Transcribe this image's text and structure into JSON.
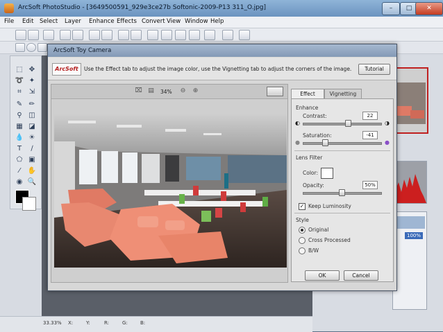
{
  "app": {
    "title": "ArcSoft PhotoStudio - [3649500591_929e3ce27b Softonic-2009-P13 311_O.jpg]",
    "window_buttons": {
      "minimize": "–",
      "maximize": "□",
      "close": "✕"
    },
    "menu": [
      "File",
      "Edit",
      "Select",
      "Layer",
      "Enhance",
      "Effects",
      "Convert",
      "View",
      "Window",
      "Help"
    ]
  },
  "status": {
    "zoom": "33.33%",
    "r": "R:",
    "g": "G:",
    "b": "B:",
    "y": "Y:",
    "x": "X:"
  },
  "layers": {
    "opacity": "100%"
  },
  "dialog": {
    "title": "ArcSoft Toy Camera",
    "logo": "ArcSoft",
    "instructions": "Use the Effect tab to adjust the image color, use the Vignetting tab to adjust the corners of the image.",
    "tutorial_label": "Tutorial",
    "zoom": "34%",
    "tabs": {
      "effect": "Effect",
      "vignetting": "Vignetting"
    },
    "enhance": {
      "label": "Enhance",
      "contrast_label": "Contrast:",
      "contrast_value": "22",
      "saturation_label": "Saturation:",
      "saturation_value": "-41"
    },
    "lens_filter": {
      "label": "Lens Filter",
      "color_label": "Color:",
      "opacity_label": "Opacity:",
      "opacity_value": "50%",
      "keep_luminosity_label": "Keep Luminosity",
      "keep_luminosity_checked": true
    },
    "style": {
      "label": "Style",
      "options": [
        "Original",
        "Cross Processed",
        "B/W"
      ],
      "selected": "Original"
    },
    "ok_label": "OK",
    "cancel_label": "Cancel"
  }
}
